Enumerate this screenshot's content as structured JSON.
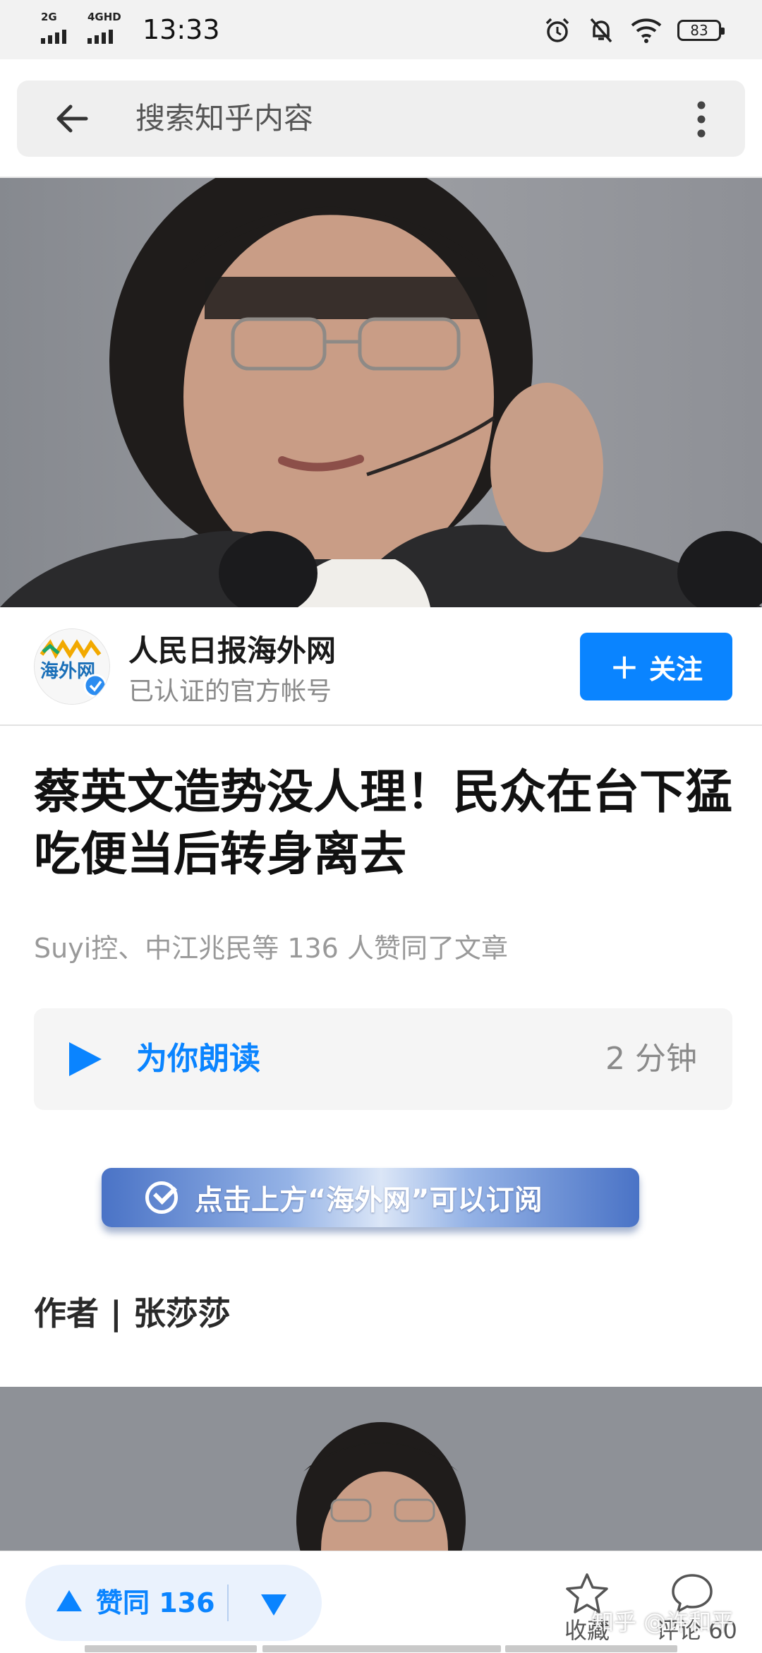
{
  "status_bar": {
    "signal1": "2G",
    "signal2": "4GHD",
    "time": "13:33",
    "battery": "83"
  },
  "search": {
    "placeholder": "搜索知乎内容"
  },
  "author": {
    "name": "人民日报海外网",
    "subtitle": "已认证的官方帐号",
    "follow_label": "关注",
    "avatar_text": "海外网"
  },
  "article": {
    "title": "蔡英文造势没人理！民众在台下猛吃便当后转身离去",
    "approvers": "Suyi控、中江兆民等 136 人赞同了文章",
    "read_label": "为你朗读",
    "read_duration": "2 分钟",
    "subscribe_banner": "点击上方“海外网”可以订阅",
    "byline": "作者 | 张莎莎"
  },
  "bottom_bar": {
    "upvote_label": "赞同 136",
    "favorite_label": "收藏",
    "comment_label": "评论 60",
    "watermark": "知乎 @许和平"
  },
  "colors": {
    "accent": "#0a84ff",
    "search_bg": "#efefef",
    "muted_text": "#999999"
  }
}
